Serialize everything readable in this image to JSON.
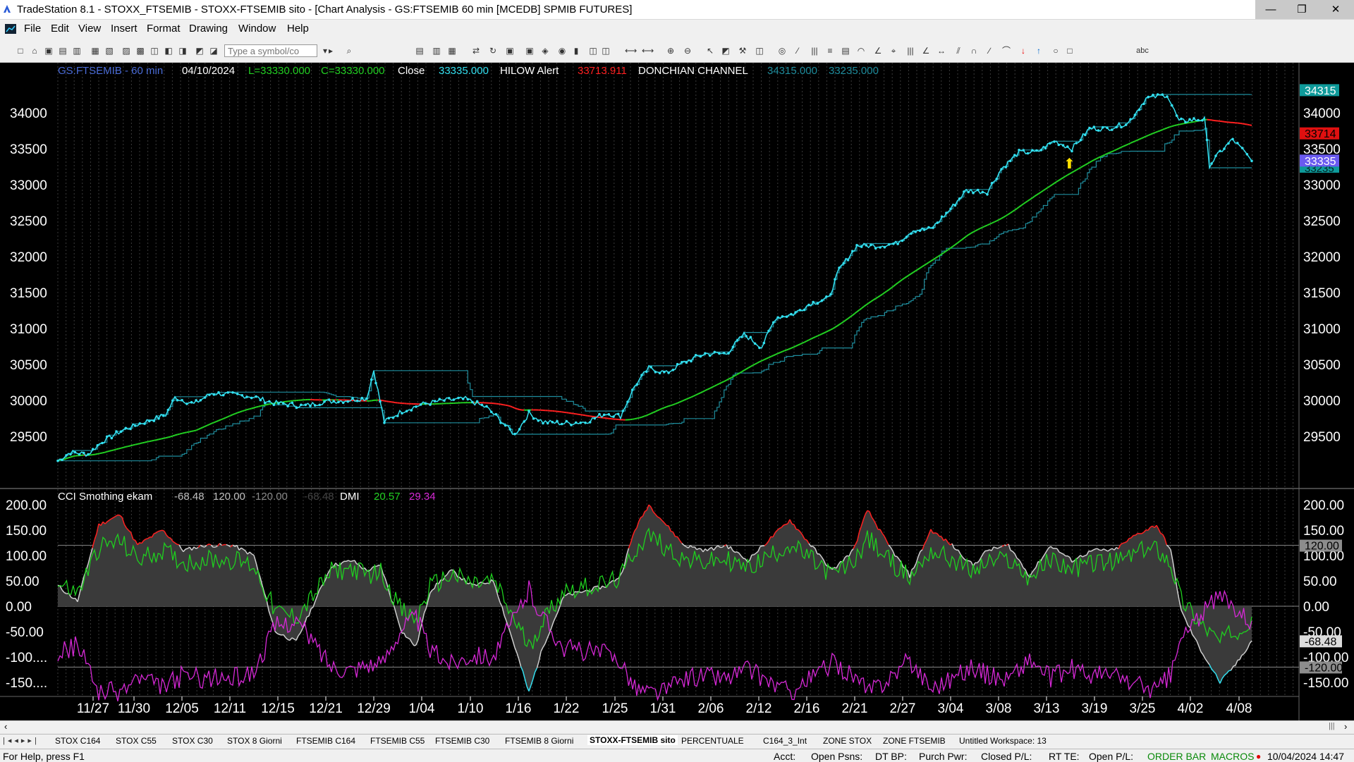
{
  "window": {
    "title": "TradeStation 8.1 - STOXX_FTSEMIB - STOXX-FTSEMIB sito - [Chart Analysis - GS:FTSEMIB  60 min  [MCEDB] SPMIB FUTURES]",
    "minimize": "—",
    "maximize": "❐",
    "close": "✕"
  },
  "menu": [
    "File",
    "Edit",
    "View",
    "Insert",
    "Format",
    "Drawing",
    "Window",
    "Help"
  ],
  "mdi_controls": [
    "–",
    "▫",
    "✕"
  ],
  "toolbar": {
    "symbol_placeholder": "Type a symbol/co",
    "text_tool": "abc"
  },
  "chart": {
    "header": {
      "symbol": "GS:FTSEMIB - 60 min",
      "date": "04/10/2024",
      "low": "L=33330.000",
      "close_val": "C=33330.000",
      "close_label": "Close",
      "close_num": "33335.000",
      "hilow_label": "HILOW Alert",
      "hilow_val": "33713.911",
      "donchian_label": "DONCHIAN CHANNEL",
      "donchian_upper": "34315.000",
      "donchian_lower": "33235.000"
    },
    "sub_header": {
      "name": "CCI Smothing ekam",
      "v1": "-68.48",
      "v2": "120.00",
      "v3": "-120.00",
      "v4": "-68.48",
      "dmi_label": "DMI",
      "dmi_plus": "20.57",
      "dmi_minus": "29.34"
    },
    "price_ticks": [
      "34000",
      "33500",
      "33000",
      "32500",
      "32000",
      "31500",
      "31000",
      "30500",
      "30000",
      "29500"
    ],
    "price_badges": {
      "upper": "34315",
      "hilow": "33714",
      "close": "33335",
      "lower": "33235"
    },
    "osc_ticks": [
      "200.00",
      "150.00",
      "100.00",
      "50.00",
      "0.00",
      "-50.00",
      "-100....",
      "-150...."
    ],
    "osc_ticks_right": [
      "200.00",
      "150.00",
      "100.00",
      "50.00",
      "0.00",
      "-50.00",
      "-100.00",
      "-150.00"
    ],
    "osc_badges": {
      "b1": "120.00",
      "b2": "-68.48",
      "b3": "-120.00"
    },
    "date_ticks": [
      "11/27",
      "11/30",
      "12/05",
      "12/11",
      "12/15",
      "12/21",
      "12/29",
      "1/04",
      "1/10",
      "1/16",
      "1/22",
      "1/25",
      "1/31",
      "2/06",
      "2/12",
      "2/16",
      "2/21",
      "2/27",
      "3/04",
      "3/08",
      "3/13",
      "3/19",
      "3/25",
      "4/02",
      "4/08"
    ],
    "colors": {
      "price": "#33e0f0",
      "ma_up": "#22d022",
      "ma_down": "#ff2020",
      "channel": "#1e8c9c",
      "dmi_plus": "#1fcf1f",
      "dmi_minus": "#d628d6",
      "cci": "#d0d0d0"
    }
  },
  "tabs": [
    "STOX C164",
    "STOX C55",
    "STOX C30",
    "STOX 8 Giorni",
    "FTSEMIB C164",
    "FTSEMIB C55",
    "FTSEMIB C30",
    "FTSEMIB 8 Giorni",
    "STOXX-FTSEMIB sito",
    "PERCENTUALE",
    "C164_3_Int",
    "ZONE STOX",
    "ZONE FTSEMIB",
    "Untitled Workspace: 13"
  ],
  "status": {
    "help": "For Help, press F1",
    "acct": "Acct:",
    "open_psns": "Open Psns:",
    "dt_bp": "DT BP:",
    "purch_pwr": "Purch Pwr:",
    "closed_pl": "Closed P/L:",
    "rt_te": "RT TE:",
    "open_pl": "Open P/L:",
    "order_bar": "ORDER BAR",
    "macros": "MACROS",
    "datetime": "10/04/2024 14:47"
  }
}
